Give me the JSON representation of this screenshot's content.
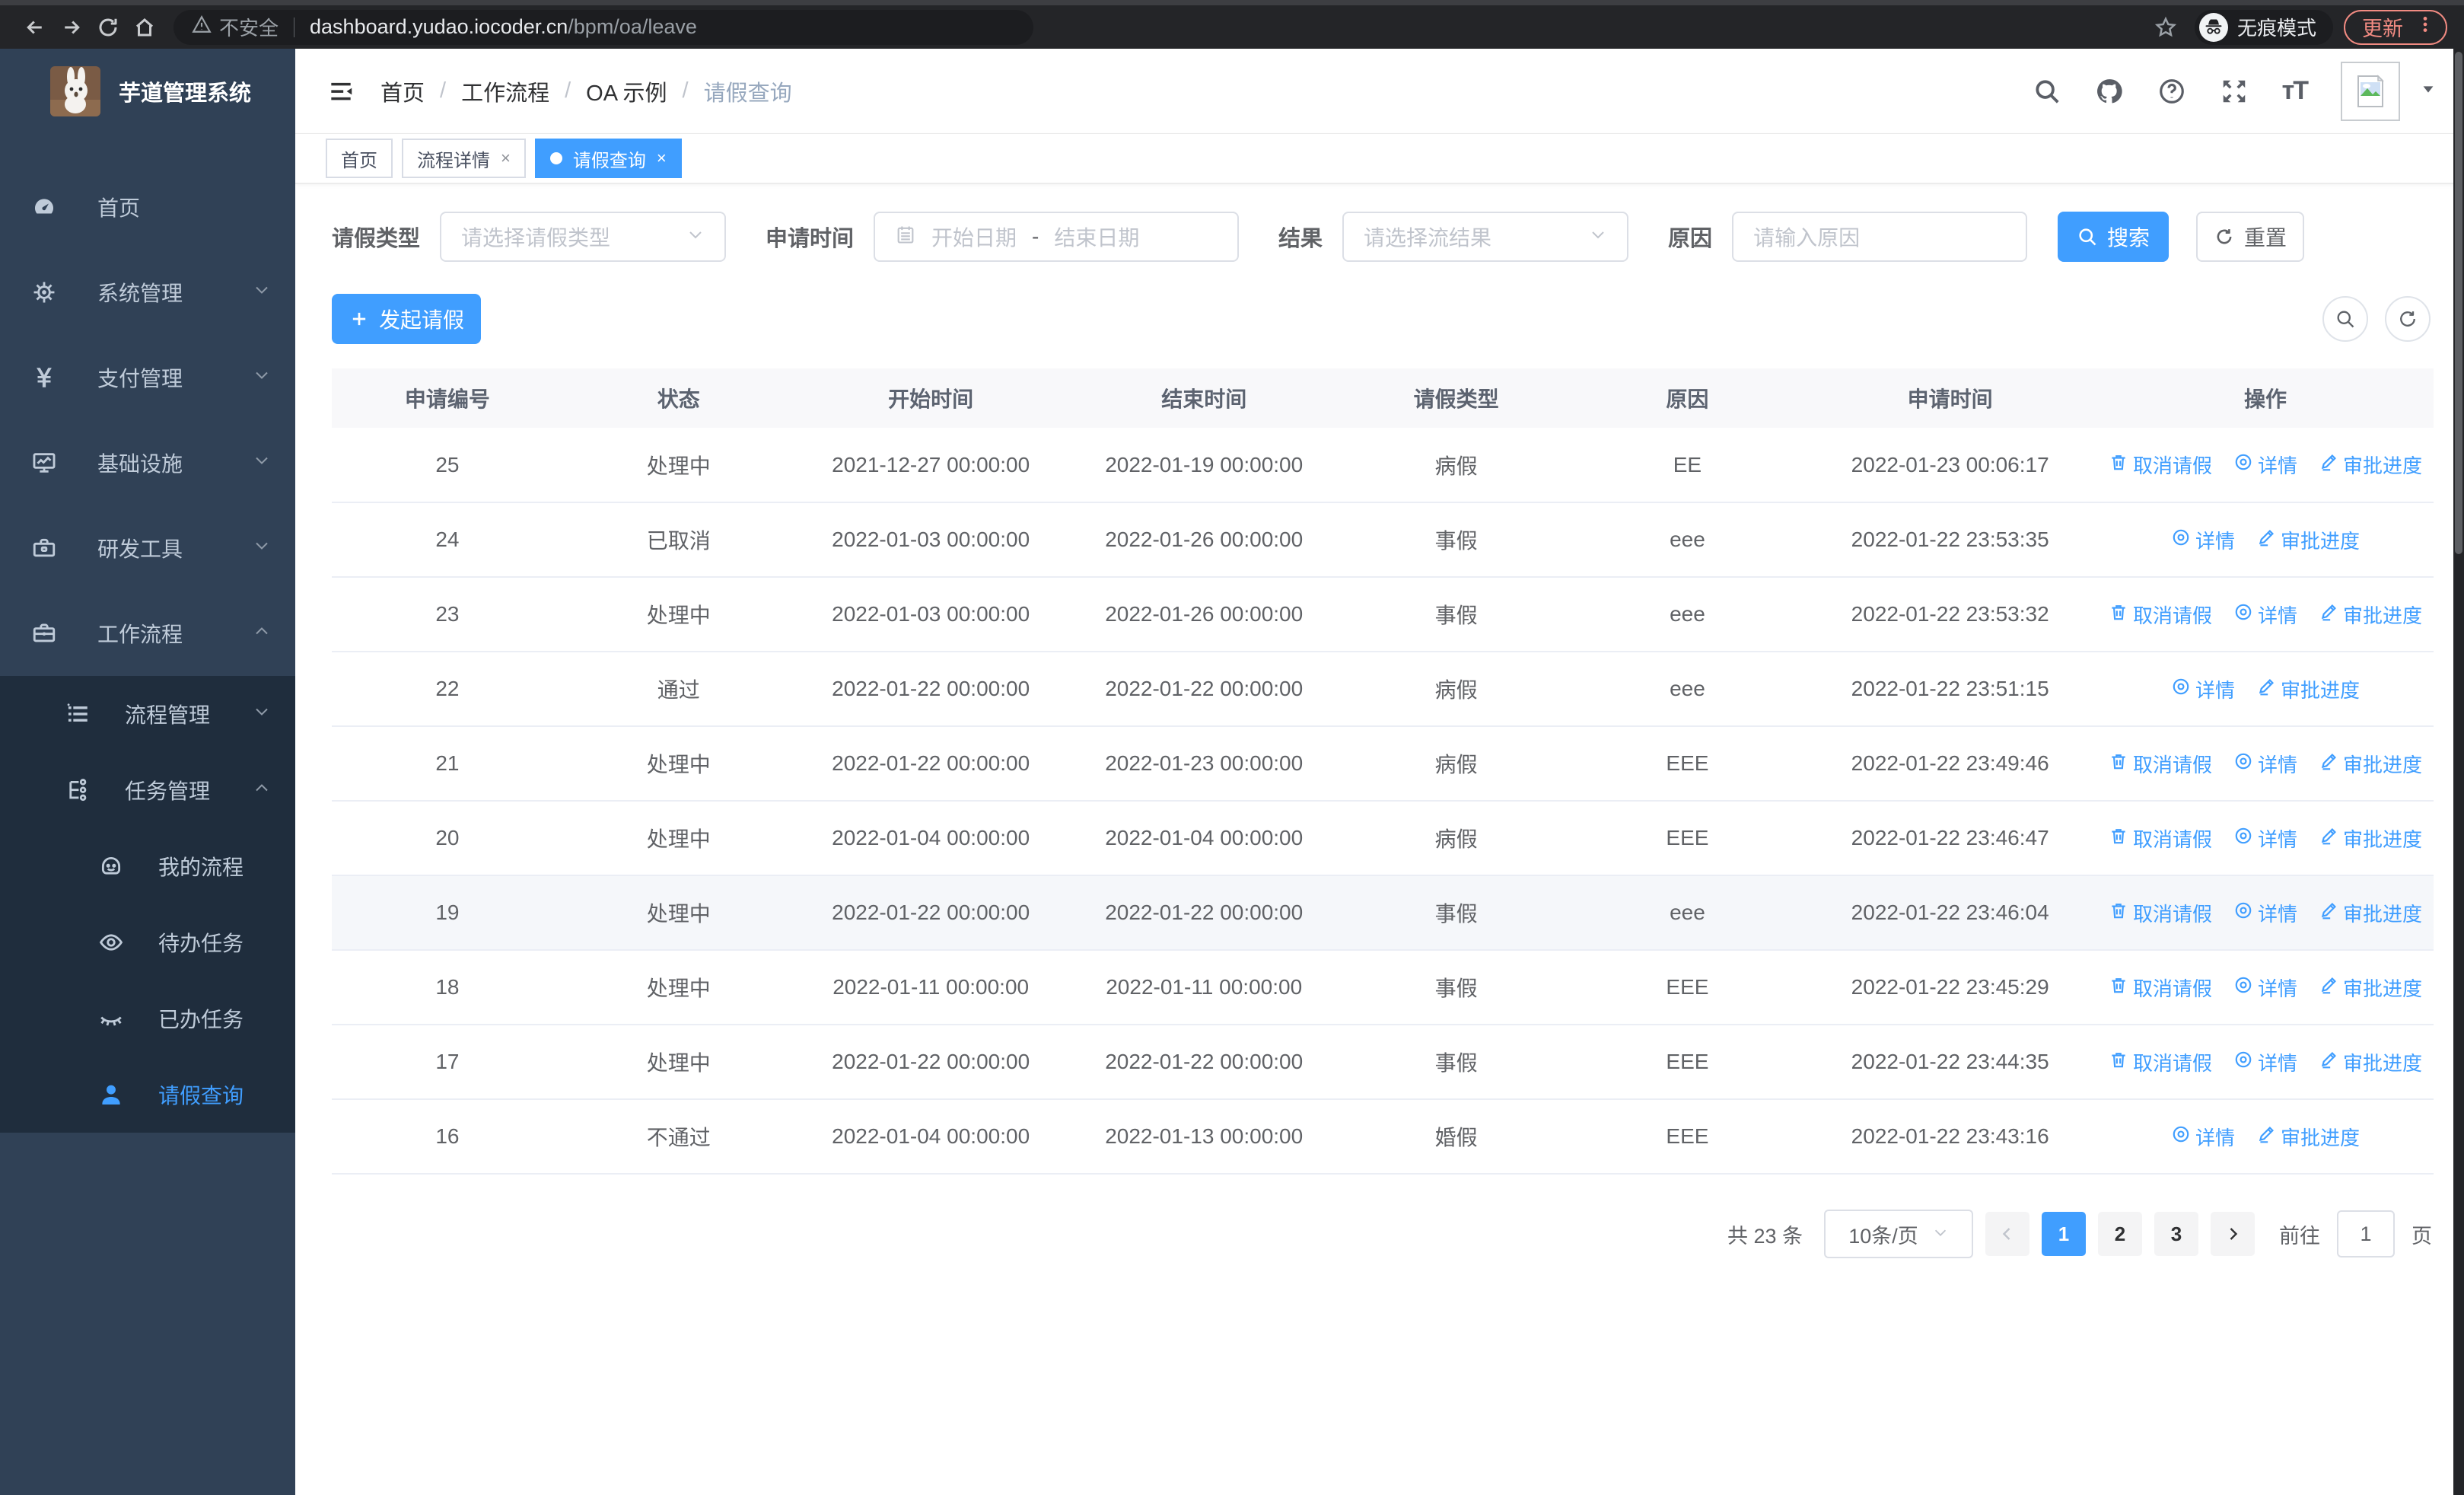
{
  "colors": {
    "accent": "#409eff",
    "sidebar_bg": "#304156",
    "submenu_bg": "#1f2d3d",
    "update_red": "#f28b82",
    "link_blue": "#409eff"
  },
  "browser": {
    "security_label": "不安全",
    "url_domain": "dashboard.yudao.iocoder.cn",
    "url_path": "/bpm/oa/leave",
    "incognito_label": "无痕模式",
    "update_label": "更新"
  },
  "sidebar": {
    "logo_title": "芋道管理系统",
    "items": [
      {
        "id": "home",
        "icon": "dashboard-icon",
        "label": "首页",
        "type": "item"
      },
      {
        "id": "system-mgmt",
        "icon": "gear-icon",
        "label": "系统管理",
        "type": "submenu",
        "state": "collapsed"
      },
      {
        "id": "pay-mgmt",
        "icon": "yen-icon",
        "label": "支付管理",
        "type": "submenu",
        "state": "collapsed"
      },
      {
        "id": "infrastructure",
        "icon": "monitor-icon",
        "label": "基础设施",
        "type": "submenu",
        "state": "collapsed"
      },
      {
        "id": "dev-tools",
        "icon": "toolbox-icon",
        "label": "研发工具",
        "type": "submenu",
        "state": "collapsed"
      },
      {
        "id": "workflow",
        "icon": "briefcase-icon",
        "label": "工作流程",
        "type": "submenu",
        "state": "expanded",
        "children": [
          {
            "id": "process-mgmt",
            "icon": "list-icon",
            "label": "流程管理",
            "type": "submenu",
            "state": "collapsed"
          },
          {
            "id": "task-mgmt",
            "icon": "tree-icon",
            "label": "任务管理",
            "type": "submenu",
            "state": "expanded",
            "children": [
              {
                "id": "my-process",
                "icon": "robot-icon",
                "label": "我的流程"
              },
              {
                "id": "todo-tasks",
                "icon": "eye-open-icon",
                "label": "待办任务"
              },
              {
                "id": "done-tasks",
                "icon": "eye-closed-icon",
                "label": "已办任务"
              },
              {
                "id": "leave-query",
                "icon": "user-icon",
                "label": "请假查询",
                "active": true
              }
            ]
          }
        ]
      }
    ]
  },
  "header": {
    "breadcrumb": [
      {
        "label": "首页"
      },
      {
        "label": "工作流程"
      },
      {
        "label": "OA 示例"
      },
      {
        "label": "请假查询",
        "current": true
      }
    ]
  },
  "tags": [
    {
      "label": "首页",
      "closable": false,
      "active": false
    },
    {
      "label": "流程详情",
      "closable": true,
      "active": false
    },
    {
      "label": "请假查询",
      "closable": true,
      "active": true
    }
  ],
  "filters": {
    "leave_type": {
      "label": "请假类型",
      "placeholder": "请选择请假类型"
    },
    "apply_time": {
      "label": "申请时间",
      "start_placeholder": "开始日期",
      "separator": "-",
      "end_placeholder": "结束日期"
    },
    "result": {
      "label": "结果",
      "placeholder": "请选择流结果"
    },
    "reason": {
      "label": "原因",
      "placeholder": "请输入原因"
    },
    "search_label": "搜索",
    "reset_label": "重置"
  },
  "toolbar": {
    "create_label": "发起请假"
  },
  "table": {
    "columns": [
      "申请编号",
      "状态",
      "开始时间",
      "结束时间",
      "请假类型",
      "原因",
      "申请时间",
      "操作"
    ],
    "action_labels": {
      "cancel": "取消请假",
      "detail": "详情",
      "progress": "审批进度"
    },
    "rows": [
      {
        "id": "25",
        "status": "处理中",
        "start": "2021-12-27 00:00:00",
        "end": "2022-01-19 00:00:00",
        "type": "病假",
        "reason": "EE",
        "apply": "2022-01-23 00:06:17",
        "actions": [
          "cancel",
          "detail",
          "progress"
        ],
        "highlighted": false
      },
      {
        "id": "24",
        "status": "已取消",
        "start": "2022-01-03 00:00:00",
        "end": "2022-01-26 00:00:00",
        "type": "事假",
        "reason": "eee",
        "apply": "2022-01-22 23:53:35",
        "actions": [
          "detail",
          "progress"
        ],
        "highlighted": false
      },
      {
        "id": "23",
        "status": "处理中",
        "start": "2022-01-03 00:00:00",
        "end": "2022-01-26 00:00:00",
        "type": "事假",
        "reason": "eee",
        "apply": "2022-01-22 23:53:32",
        "actions": [
          "cancel",
          "detail",
          "progress"
        ],
        "highlighted": false
      },
      {
        "id": "22",
        "status": "通过",
        "start": "2022-01-22 00:00:00",
        "end": "2022-01-22 00:00:00",
        "type": "病假",
        "reason": "eee",
        "apply": "2022-01-22 23:51:15",
        "actions": [
          "detail",
          "progress"
        ],
        "highlighted": false
      },
      {
        "id": "21",
        "status": "处理中",
        "start": "2022-01-22 00:00:00",
        "end": "2022-01-23 00:00:00",
        "type": "病假",
        "reason": "EEE",
        "apply": "2022-01-22 23:49:46",
        "actions": [
          "cancel",
          "detail",
          "progress"
        ],
        "highlighted": false
      },
      {
        "id": "20",
        "status": "处理中",
        "start": "2022-01-04 00:00:00",
        "end": "2022-01-04 00:00:00",
        "type": "病假",
        "reason": "EEE",
        "apply": "2022-01-22 23:46:47",
        "actions": [
          "cancel",
          "detail",
          "progress"
        ],
        "highlighted": false
      },
      {
        "id": "19",
        "status": "处理中",
        "start": "2022-01-22 00:00:00",
        "end": "2022-01-22 00:00:00",
        "type": "事假",
        "reason": "eee",
        "apply": "2022-01-22 23:46:04",
        "actions": [
          "cancel",
          "detail",
          "progress"
        ],
        "highlighted": true
      },
      {
        "id": "18",
        "status": "处理中",
        "start": "2022-01-11 00:00:00",
        "end": "2022-01-11 00:00:00",
        "type": "事假",
        "reason": "EEE",
        "apply": "2022-01-22 23:45:29",
        "actions": [
          "cancel",
          "detail",
          "progress"
        ],
        "highlighted": false
      },
      {
        "id": "17",
        "status": "处理中",
        "start": "2022-01-22 00:00:00",
        "end": "2022-01-22 00:00:00",
        "type": "事假",
        "reason": "EEE",
        "apply": "2022-01-22 23:44:35",
        "actions": [
          "cancel",
          "detail",
          "progress"
        ],
        "highlighted": false
      },
      {
        "id": "16",
        "status": "不通过",
        "start": "2022-01-04 00:00:00",
        "end": "2022-01-13 00:00:00",
        "type": "婚假",
        "reason": "EEE",
        "apply": "2022-01-22 23:43:16",
        "actions": [
          "detail",
          "progress"
        ],
        "highlighted": false
      }
    ]
  },
  "pagination": {
    "total_text": "共 23 条",
    "page_size": "10条/页",
    "pages": [
      "1",
      "2",
      "3"
    ],
    "active_page": "1",
    "goto_label": "前往",
    "goto_value": "1",
    "page_suffix": "页"
  }
}
